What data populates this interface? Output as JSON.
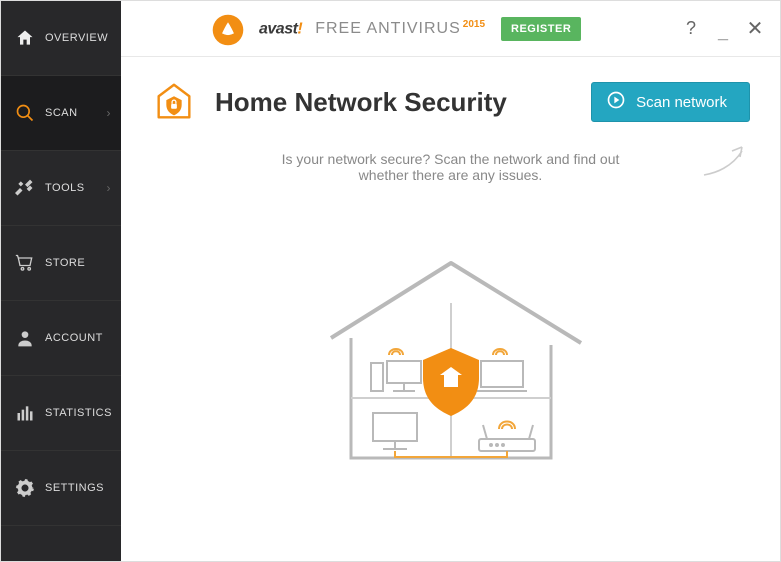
{
  "sidebar": {
    "items": [
      {
        "label": "OVERVIEW"
      },
      {
        "label": "SCAN"
      },
      {
        "label": "TOOLS"
      },
      {
        "label": "STORE"
      },
      {
        "label": "ACCOUNT"
      },
      {
        "label": "STATISTICS"
      },
      {
        "label": "SETTINGS"
      }
    ]
  },
  "topbar": {
    "brand_name": "avast",
    "brand_excl": "!",
    "product": "FREE ANTIVIRUS",
    "year": "2015",
    "register_label": "REGISTER"
  },
  "page": {
    "title": "Home Network Security",
    "scan_button": "Scan network",
    "prompt_line1": "Is your network secure? Scan the network and find out",
    "prompt_line2": "whether there are any issues."
  }
}
